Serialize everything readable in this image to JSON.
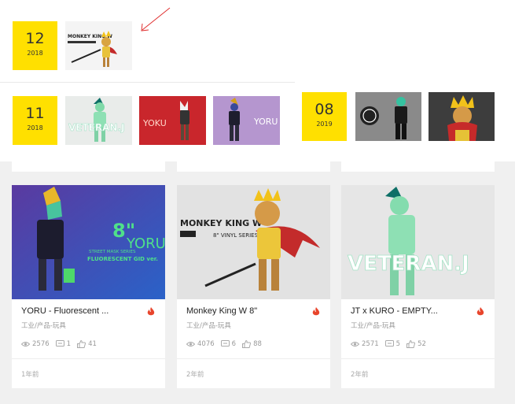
{
  "timeline": [
    {
      "day": "12",
      "year": "2018",
      "thumb_count": 1
    },
    {
      "day": "11",
      "year": "2018",
      "thumb_count": 3
    },
    {
      "day": "08",
      "year": "2019",
      "thumb_count": 2
    }
  ],
  "thumbnails": {
    "dec_2018": [
      "Monkey King W figure"
    ],
    "nov_2018": [
      "Veteran.J figure",
      "Yoku figure",
      "Yoru figure"
    ],
    "aug_2019": [
      "Kuro figure",
      "Monkey King figure"
    ]
  },
  "thumb_text": {
    "monkey_king_w": "MONKEY KING W",
    "veteran_j": "VETERAN.J",
    "yoku": "YOKU",
    "yoru": "YORU"
  },
  "cards": [
    {
      "title": "YORU - Fluorescent ...",
      "category": "工业/产品-玩具",
      "views": "2576",
      "comments": "1",
      "likes": "41",
      "time": "1年前",
      "img_text": {
        "size": "8\"",
        "name": "YORU",
        "line1": "STREET MASK SERIES",
        "line2": "FLUORESCENT GID ver."
      }
    },
    {
      "title": "Monkey King W 8\"",
      "category": "工业/产品-玩具",
      "views": "4076",
      "comments": "6",
      "likes": "88",
      "time": "2年前",
      "img_text": {
        "name": "MONKEY KING W",
        "line1": "8\" VINYL SERIES"
      }
    },
    {
      "title": "JT x KURO - EMPTY...",
      "category": "工业/产品-玩具",
      "views": "2571",
      "comments": "5",
      "likes": "52",
      "time": "2年前",
      "img_text": {
        "name": "VETERAN.J"
      }
    }
  ],
  "colors": {
    "date_bg": "#ffe000",
    "fire": "#e8452c",
    "arrow": "#e03030"
  },
  "icons": [
    "eye-icon",
    "comment-icon",
    "thumbs-up-icon",
    "fire-icon",
    "arrow-annotation"
  ]
}
